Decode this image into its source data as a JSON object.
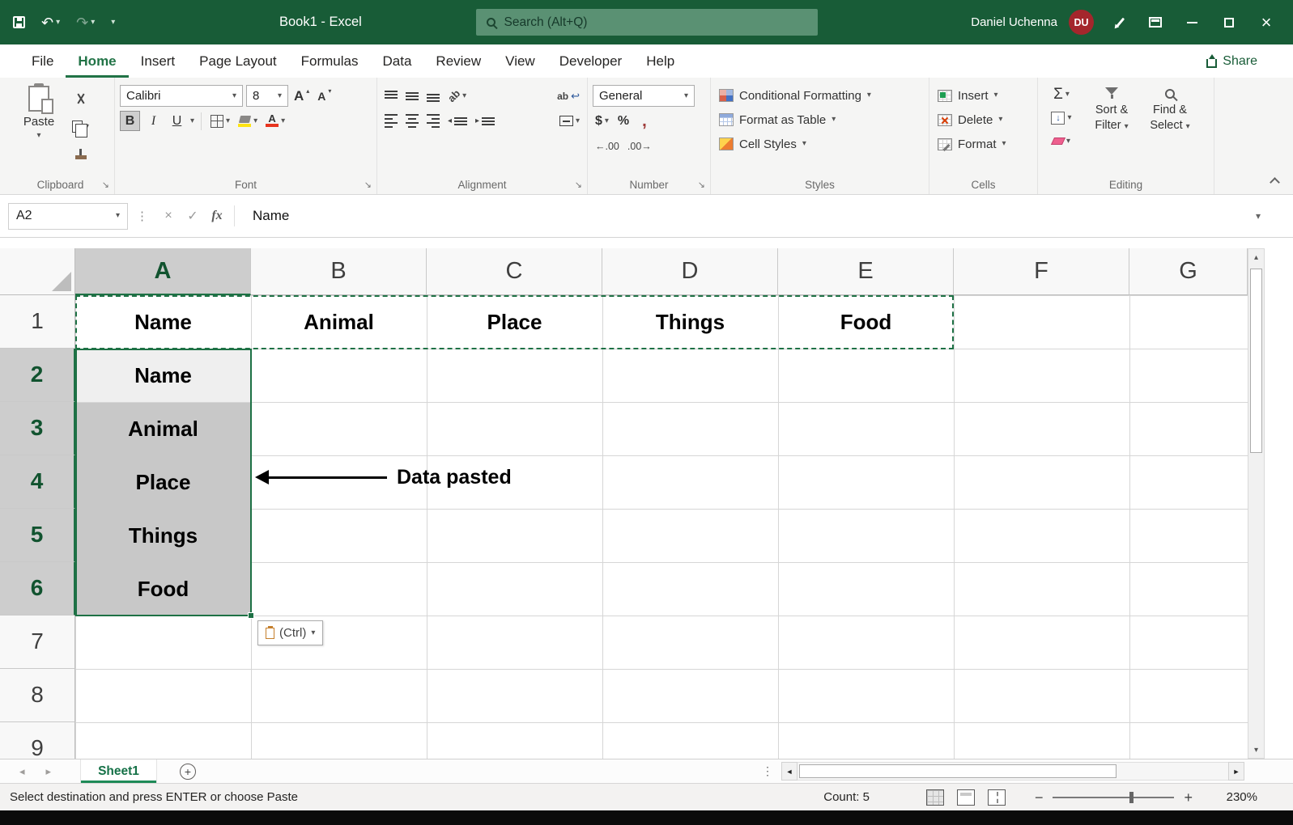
{
  "glyphs": {
    "chevron_down": "▾",
    "triangle_up": "▴",
    "nav_left": "◂",
    "nav_right": "▸",
    "scroll_left": "◄",
    "scroll_right": "►",
    "check": "✓",
    "close_x": "×",
    "sigma": "Σ",
    "fx": "fx",
    "dots": "⋮",
    "undo": "↶",
    "redo": "↷",
    "dollar": "$",
    "percent": "%",
    "comma": ",",
    "launcher": "↘",
    "plus": "+",
    "minus": "−",
    "arrow_down": "↓",
    "inc_decimal": "←.00",
    "dec_decimal": ".00→",
    "letter_a": "A",
    "ab": "ab",
    "wrap_arrow": "↩"
  },
  "title_bar": {
    "title": "Book1 - Excel",
    "search_placeholder": "Search (Alt+Q)",
    "user_name": "Daniel Uchenna",
    "user_initials": "DU"
  },
  "tabs": {
    "items": [
      "File",
      "Home",
      "Insert",
      "Page Layout",
      "Formulas",
      "Data",
      "Review",
      "View",
      "Developer",
      "Help"
    ],
    "share": "Share"
  },
  "ribbon": {
    "clipboard": {
      "group": "Clipboard",
      "paste": "Paste"
    },
    "font": {
      "group": "Font",
      "family": "Calibri",
      "size": "8",
      "bold": "B",
      "italic": "I",
      "underline": "U"
    },
    "alignment": {
      "group": "Alignment"
    },
    "number": {
      "group": "Number",
      "format": "General"
    },
    "styles": {
      "group": "Styles",
      "conditional": "Conditional Formatting",
      "table": "Format as Table",
      "cell_styles": "Cell Styles"
    },
    "cells": {
      "group": "Cells",
      "insert": "Insert",
      "delete": "Delete",
      "format": "Format"
    },
    "editing": {
      "group": "Editing",
      "sort1": "Sort &",
      "sort2": "Filter",
      "find1": "Find &",
      "find2": "Select"
    }
  },
  "formula_bar": {
    "name_box": "A2",
    "content": "Name"
  },
  "grid": {
    "col_headers": [
      "A",
      "B",
      "C",
      "D",
      "E",
      "F",
      "G"
    ],
    "row_headers": [
      "1",
      "2",
      "3",
      "4",
      "5",
      "6",
      "7",
      "8",
      "9"
    ],
    "row1": [
      "Name",
      "Animal",
      "Place",
      "Things",
      "Food"
    ],
    "colA": [
      "Name",
      "Animal",
      "Place",
      "Things",
      "Food"
    ],
    "annotation": "Data pasted",
    "paste_options": "(Ctrl)"
  },
  "sheet_bar": {
    "sheet": "Sheet1"
  },
  "status_bar": {
    "message": "Select destination and press ENTER or choose Paste",
    "count": "Count: 5",
    "zoom": "230%"
  }
}
